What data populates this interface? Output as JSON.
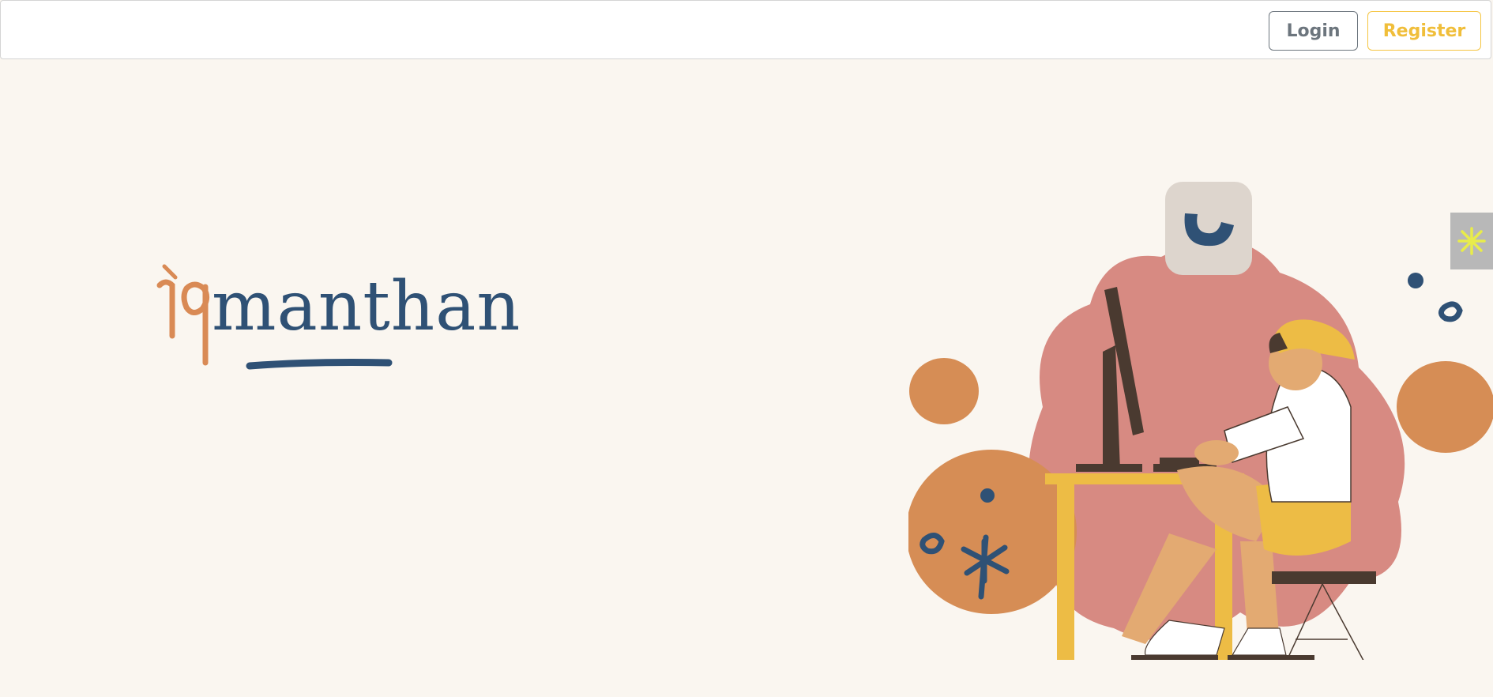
{
  "navbar": {
    "login_label": "Login",
    "register_label": "Register"
  },
  "hero": {
    "logo_prefix": "iq",
    "logo_word": "manthan"
  },
  "side_widget": {
    "icon": "asterisk-icon"
  },
  "colors": {
    "background": "#FAF6F0",
    "brand_orange": "#D98A55",
    "brand_blue": "#2F5175",
    "accent_yellow": "#F0BE3A",
    "muted_gray": "#6C757D"
  }
}
